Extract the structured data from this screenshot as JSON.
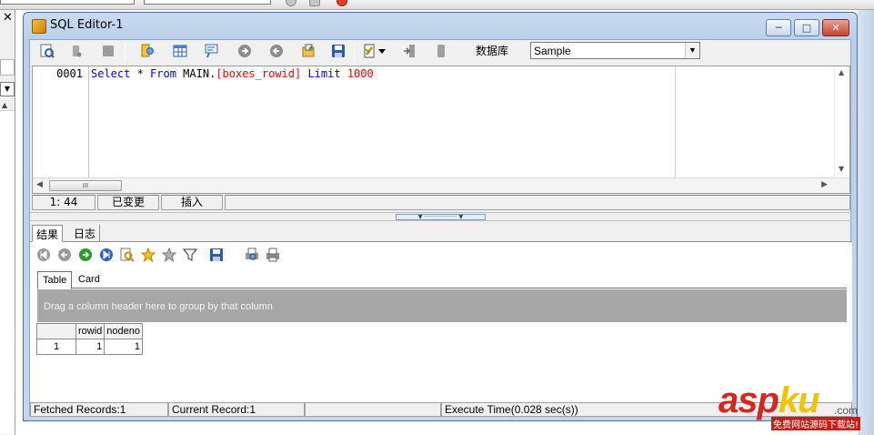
{
  "window": {
    "title": "SQL Editor-1",
    "controls": {
      "minimize": "─",
      "maximize": "□",
      "close": "✕"
    }
  },
  "toolbar": {
    "database_label": "数据库",
    "database_value": "Sample",
    "icons": [
      "execute-icon",
      "stop-icon",
      "pause-icon",
      "sql-helper-icon",
      "grid-icon",
      "comment-icon",
      "forward-icon",
      "back-icon",
      "open-file-icon",
      "save-icon",
      "history-icon",
      "dropdown-arrow-icon",
      "export-icon",
      "clear-icon"
    ]
  },
  "editor": {
    "line_number": "0001",
    "code": {
      "kw_select": "Select",
      "star": " * ",
      "kw_from": "From",
      "schema": " MAIN.",
      "table": "[boxes_rowid]",
      "kw_limit": " Limit",
      "limit_value": " 1000"
    },
    "hscroll_thumb": "III"
  },
  "editor_status": {
    "position": "1: 44",
    "modified": "已变更",
    "mode": "插入"
  },
  "result_tabs": [
    "结果",
    "日志"
  ],
  "result_toolbar": {
    "icons": [
      "first-record-icon",
      "prev-record-icon",
      "next-record-icon",
      "last-record-icon",
      "find-icon",
      "favorite-icon",
      "favorites-list-icon",
      "filter-icon",
      "save-icon",
      "print-preview-icon",
      "print-icon"
    ]
  },
  "view_tabs": [
    "Table",
    "Card"
  ],
  "group_panel_text": "Drag a column header here to group by that column",
  "grid": {
    "columns": [
      "rowid",
      "nodeno"
    ],
    "rows": [
      {
        "rowno": "1",
        "values": [
          "1",
          "1"
        ]
      }
    ]
  },
  "status_bar": {
    "fetched": "Fetched Records:1",
    "current": "Current Record:1",
    "empty": "",
    "execute_time": "Execute Time(0.028 sec(s))"
  },
  "watermark": {
    "asp": "asp",
    "ku": "ku",
    "com": ".com",
    "sub": "免费网站源码下载站!"
  },
  "colors": {
    "keyword": "#0000ff",
    "identifier_bracket": "#ff0000",
    "group_panel": "#a7a7a7",
    "title_bar": "#c9dbf0"
  }
}
